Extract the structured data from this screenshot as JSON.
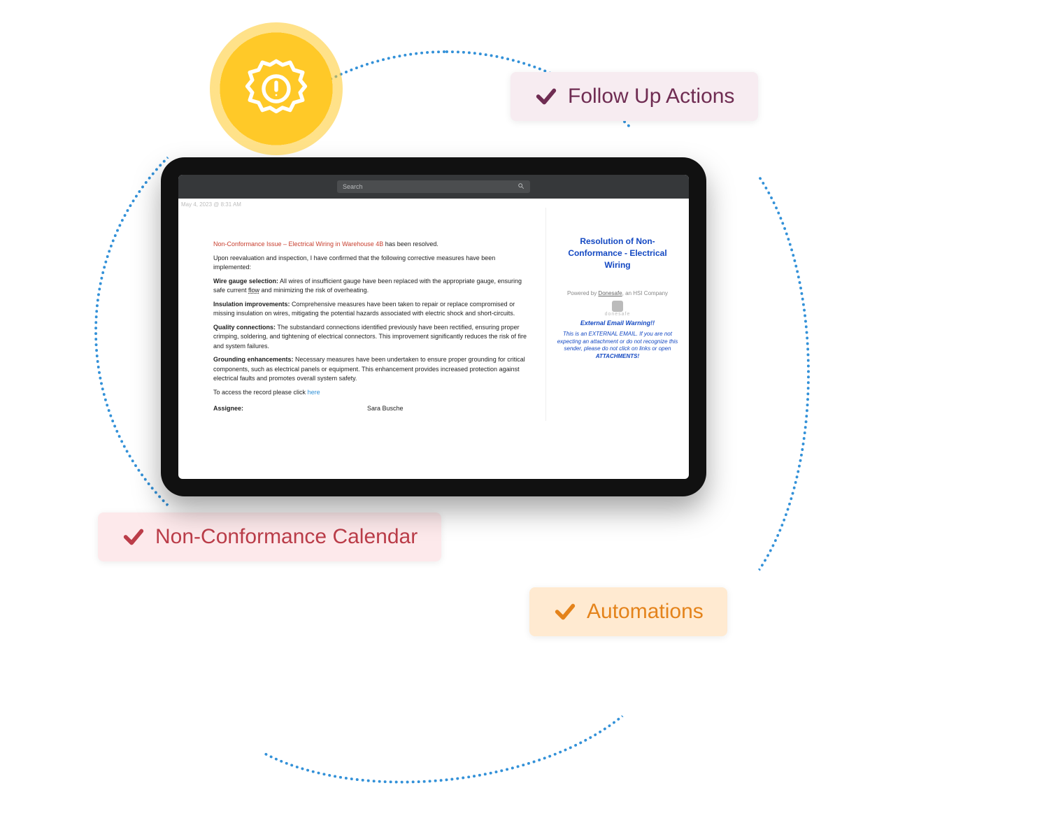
{
  "cards": {
    "followup_label": "Follow Up Actions",
    "nonconformance_label": "Non-Conformance Calendar",
    "automations_label": "Automations"
  },
  "icon_names": {
    "gear_alert": "gear-alert-icon",
    "check": "check-icon",
    "search": "search-icon"
  },
  "tablet": {
    "search_placeholder": "Search",
    "timestamp": "May 4, 2023 @ 8:31 AM",
    "main": {
      "issue_label": "Non-Conformance Issue – Electrical Wiring in Warehouse 4B",
      "issue_status": " has been resolved.",
      "intro": "Upon reevaluation and inspection, I have confirmed that the following corrective measures have been implemented:",
      "wire_gauge_label": "Wire gauge selection:",
      "wire_gauge_body_1": " All wires of insufficient gauge have been replaced with the appropriate gauge, ensuring safe current ",
      "wire_gauge_flow": "flow",
      "wire_gauge_body_2": " and minimizing the risk of overheating.",
      "insulation_label": "Insulation improvements:",
      "insulation_body": " Comprehensive measures have been taken to repair or replace compromised or missing insulation on wires, mitigating the potential hazards associated with electric shock and short-circuits.",
      "quality_label": "Quality connections:",
      "quality_body": " The substandard connections identified previously have been rectified, ensuring proper crimping, soldering, and tightening of electrical connectors. This improvement significantly reduces the risk of fire and system failures.",
      "ground_label": "Grounding enhancements:",
      "ground_body": " Necessary measures have been undertaken to ensure proper grounding for critical components, such as electrical panels or equipment. This enhancement provides increased protection against electrical faults and promotes overall system safety.",
      "access_prefix": "To access the record please click ",
      "access_link": "here",
      "assignee_label": "Assignee:",
      "assignee_value": "Sara Busche"
    },
    "side": {
      "title_line1": "Resolution of Non-",
      "title_line2": "Conformance - Electrical",
      "title_line3": "Wiring",
      "powered_prefix": "Powered by ",
      "powered_brand": "Donesafe",
      "powered_suffix": ", an HSI Company",
      "brand_small": "donesafe",
      "ext_warn": "External Email Warning!!",
      "ext_body_prefix": "This is an EXTERNAL EMAIL. If you are not expecting an attachment or do not recognize this sender, please do not click on links or open ",
      "ext_body_attach": "ATTACHMENTS!"
    }
  }
}
